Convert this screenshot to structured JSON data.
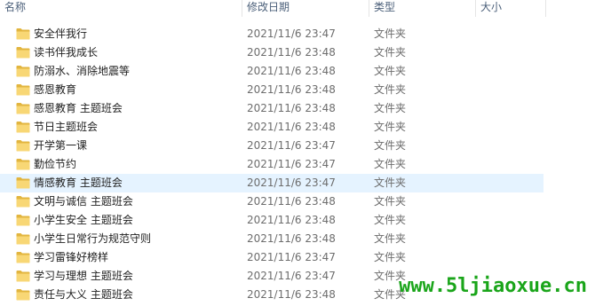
{
  "columns": {
    "name": "名称",
    "date": "修改日期",
    "type": "类型",
    "size": "大小"
  },
  "colors": {
    "folder": "#f8d775",
    "folder_dark": "#e2b53f",
    "hover": "#e5f3ff",
    "watermark": "#1aa51a"
  },
  "icon": "folder-icon",
  "rows": [
    {
      "name": "安全伴我行",
      "date": "2021/11/6 23:47",
      "type": "文件夹",
      "size": ""
    },
    {
      "name": "读书伴我成长",
      "date": "2021/11/6 23:48",
      "type": "文件夹",
      "size": ""
    },
    {
      "name": "防溺水、消除地震等",
      "date": "2021/11/6 23:48",
      "type": "文件夹",
      "size": ""
    },
    {
      "name": "感恩教育",
      "date": "2021/11/6 23:48",
      "type": "文件夹",
      "size": ""
    },
    {
      "name": "感恩教育 主题班会",
      "date": "2021/11/6 23:48",
      "type": "文件夹",
      "size": ""
    },
    {
      "name": "节日主题班会",
      "date": "2021/11/6 23:48",
      "type": "文件夹",
      "size": ""
    },
    {
      "name": "开学第一课",
      "date": "2021/11/6 23:47",
      "type": "文件夹",
      "size": ""
    },
    {
      "name": "勤俭节约",
      "date": "2021/11/6 23:47",
      "type": "文件夹",
      "size": ""
    },
    {
      "name": "情感教育 主题班会",
      "date": "2021/11/6 23:47",
      "type": "文件夹",
      "size": "",
      "hover": true
    },
    {
      "name": "文明与诚信 主题班会",
      "date": "2021/11/6 23:48",
      "type": "文件夹",
      "size": ""
    },
    {
      "name": "小学生安全 主题班会",
      "date": "2021/11/6 23:48",
      "type": "文件夹",
      "size": ""
    },
    {
      "name": "小学生日常行为规范守则",
      "date": "2021/11/6 23:48",
      "type": "文件夹",
      "size": ""
    },
    {
      "name": "学习雷锋好榜样",
      "date": "2021/11/6 23:47",
      "type": "文件夹",
      "size": ""
    },
    {
      "name": "学习与理想 主题班会",
      "date": "2021/11/6 23:47",
      "type": "文件夹",
      "size": ""
    },
    {
      "name": "责任与大义 主题班会",
      "date": "2021/11/6 23:48",
      "type": "文件夹",
      "size": ""
    }
  ],
  "watermark": "www.5ljiaoxue.cn"
}
